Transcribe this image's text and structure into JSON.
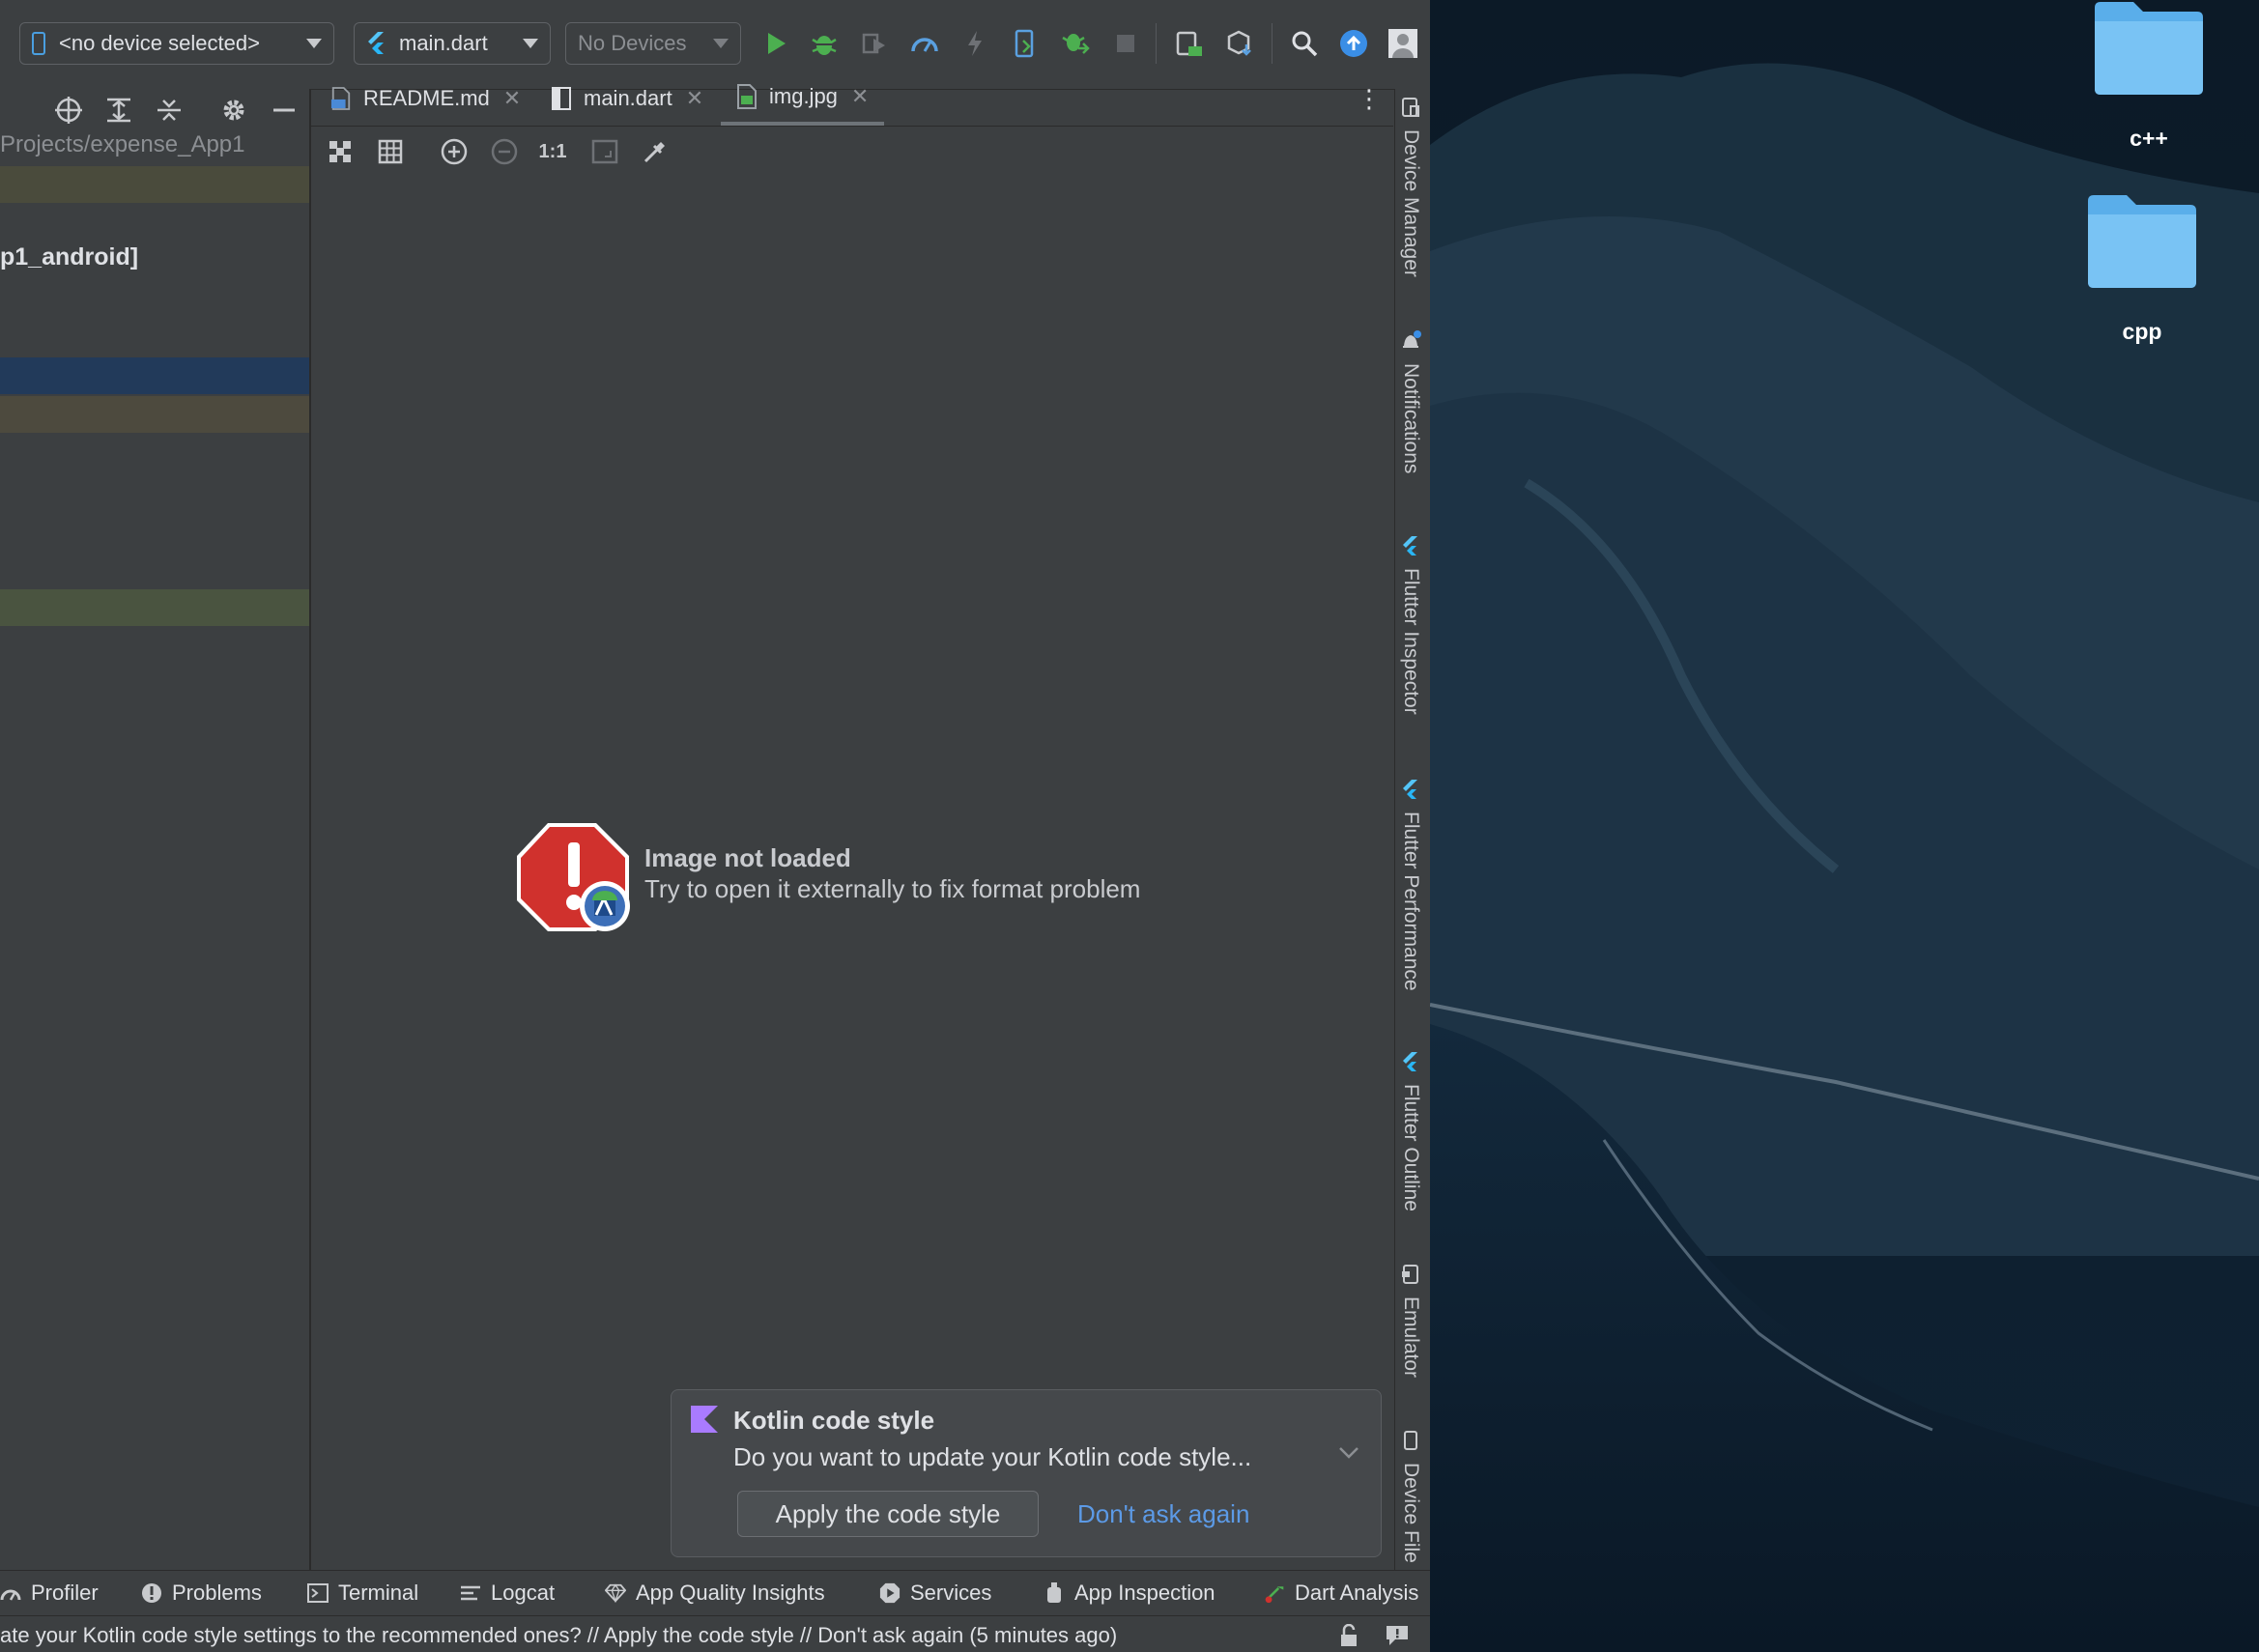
{
  "toolbar": {
    "device_selector": "<no device selected>",
    "run_config": "main.dart",
    "devices_combo": "No Devices"
  },
  "project": {
    "path": "Projects/expense_App1",
    "android_module": "p1_android]"
  },
  "tabs": [
    {
      "label": "README.md",
      "active": false
    },
    {
      "label": "main.dart",
      "active": false
    },
    {
      "label": "img.jpg",
      "active": true
    }
  ],
  "image_toolbar": {
    "actual_size_label": "1:1"
  },
  "editor": {
    "error_title": "Image not loaded",
    "error_message": "Try to open it externally to fix format problem"
  },
  "right_tools": [
    {
      "label": "Device Manager",
      "icon": "device-manager-icon"
    },
    {
      "label": "Notifications",
      "icon": "bell-icon"
    },
    {
      "label": "Flutter Inspector",
      "icon": "flutter-icon"
    },
    {
      "label": "Flutter Performance",
      "icon": "flutter-icon"
    },
    {
      "label": "Flutter Outline",
      "icon": "flutter-icon"
    },
    {
      "label": "Emulator",
      "icon": "emulator-icon"
    },
    {
      "label": "Device File",
      "icon": "device-file-icon"
    }
  ],
  "notification": {
    "title": "Kotlin code style",
    "body": "Do you want to update your Kotlin code style...",
    "apply_button": "Apply the code style",
    "dismiss_link": "Don't ask again"
  },
  "bottom_tools": [
    {
      "label": "Profiler",
      "icon": "profiler-icon"
    },
    {
      "label": "Problems",
      "icon": "problems-icon"
    },
    {
      "label": "Terminal",
      "icon": "terminal-icon"
    },
    {
      "label": "Logcat",
      "icon": "logcat-icon"
    },
    {
      "label": "App Quality Insights",
      "icon": "diamond-icon"
    },
    {
      "label": "Services",
      "icon": "services-icon"
    },
    {
      "label": "App Inspection",
      "icon": "app-inspection-icon"
    },
    {
      "label": "Dart Analysis",
      "icon": "dart-analysis-icon"
    }
  ],
  "status_bar": {
    "message": "ate your Kotlin code style settings to the recommended ones? // Apply the code style // Don't ask again (5 minutes ago)"
  },
  "desktop": {
    "folders": [
      {
        "label": "c++"
      },
      {
        "label": "cpp"
      }
    ]
  },
  "colors": {
    "ide_background": "#3c3f41",
    "accent_blue": "#5c9ae6",
    "run_green": "#4caf50",
    "folder_blue": "#6bbdf2",
    "error_red": "#d0312d"
  }
}
